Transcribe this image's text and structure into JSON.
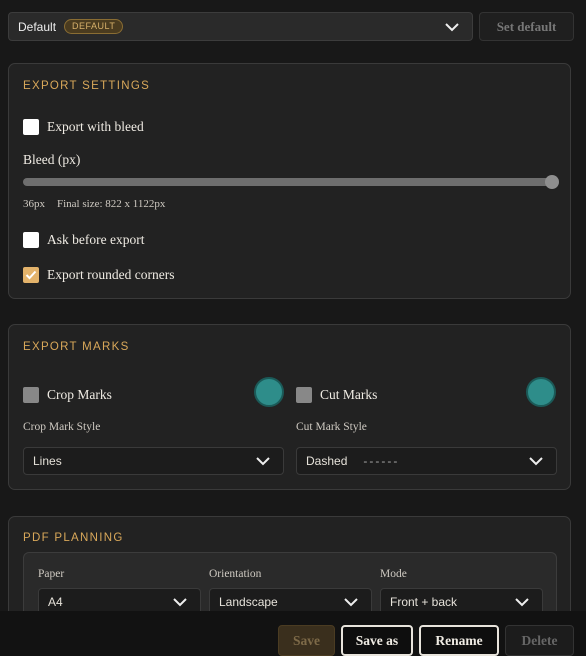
{
  "top": {
    "profile_name": "Default",
    "profile_badge": "DEFAULT",
    "set_default_label": "Set default"
  },
  "export_settings": {
    "title": "EXPORT SETTINGS",
    "export_with_bleed_label": "Export with bleed",
    "export_with_bleed_checked": false,
    "bleed_label": "Bleed (px)",
    "bleed_value": "36px",
    "bleed_slider_fraction": 1.0,
    "final_size": "Final size: 822 x 1122px",
    "ask_before_export_label": "Ask before export",
    "ask_before_export_checked": false,
    "rounded_corners_label": "Export rounded corners",
    "rounded_corners_checked": true
  },
  "export_marks": {
    "title": "EXPORT MARKS",
    "crop_marks_label": "Crop Marks",
    "cut_marks_label": "Cut Marks",
    "crop_style_label": "Crop Mark Style",
    "cut_style_label": "Cut Mark Style",
    "crop_style_value": "Lines",
    "cut_style_value": "Dashed",
    "cut_style_preview": "------",
    "mark_color": "#2e8d8a"
  },
  "pdf_planning": {
    "title": "PDF PLANNING",
    "paper_label": "Paper",
    "paper_value": "A4",
    "orientation_label": "Orientation",
    "orientation_value": "Landscape",
    "mode_label": "Mode",
    "mode_value": "Front + back"
  },
  "actions": {
    "save": "Save",
    "save_as": "Save as",
    "rename": "Rename",
    "delete": "Delete"
  },
  "colors": {
    "accent": "#d9a85a",
    "background": "#181818",
    "panel": "#222222"
  }
}
